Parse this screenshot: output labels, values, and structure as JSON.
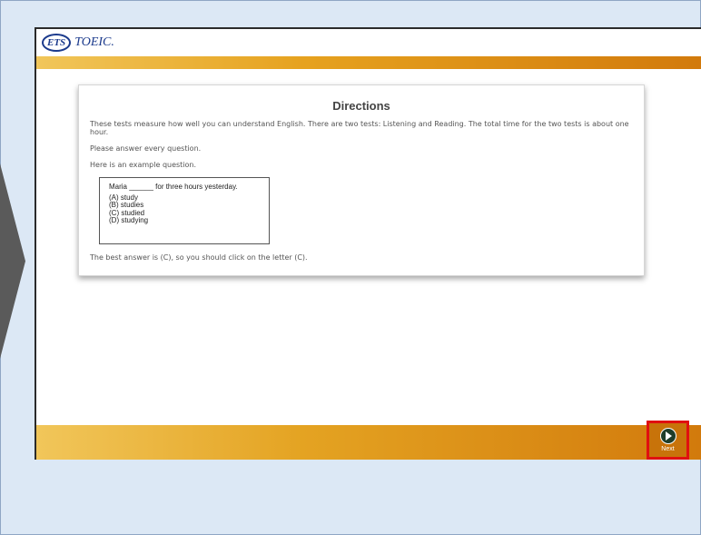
{
  "logo": {
    "ets": "ETS",
    "toeic": "TOEIC."
  },
  "directions": {
    "title": "Directions",
    "paragraph_1": "These tests measure how well you can understand English. There are two tests: Listening and Reading. The total time for the two tests is about one hour.",
    "paragraph_2": "Please answer every question.",
    "paragraph_3": "Here is an example question.",
    "example": {
      "stem": "Maria ______ for three hours yesterday.",
      "options": [
        "(A) study",
        "(B) studies",
        "(C) studied",
        "(D) studying"
      ]
    },
    "answer_note": "The best answer is (C), so you should click on the letter (C)."
  },
  "navigation": {
    "next_label": "Next"
  },
  "colors": {
    "page_background": "#dce8f5",
    "band_start": "#f1c65a",
    "band_end": "#d27a0c",
    "highlight": "#e01010",
    "brand_blue": "#1b3a8c"
  }
}
